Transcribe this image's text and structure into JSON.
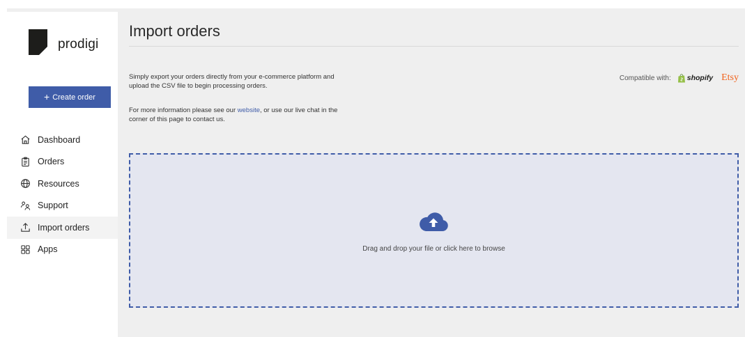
{
  "brand": {
    "name": "prodigi"
  },
  "sidebar": {
    "create_button": {
      "plus": "+",
      "label": "Create order"
    },
    "items": [
      {
        "label": "Dashboard",
        "icon": "home-icon",
        "active": false
      },
      {
        "label": "Orders",
        "icon": "clipboard-icon",
        "active": false
      },
      {
        "label": "Resources",
        "icon": "globe-icon",
        "active": false
      },
      {
        "label": "Support",
        "icon": "people-icon",
        "active": false
      },
      {
        "label": "Import orders",
        "icon": "upload-icon",
        "active": true
      },
      {
        "label": "Apps",
        "icon": "grid-icon",
        "active": false
      }
    ]
  },
  "main": {
    "title": "Import orders",
    "intro": "Simply export your orders directly from your e-commerce platform and upload the CSV file to begin processing orders.",
    "more_info": {
      "before": "For more information please see our ",
      "link": "website",
      "after": ", or use our live chat in the corner of this page to contact us."
    },
    "compatible": {
      "label": "Compatible with:",
      "platforms": [
        "shopify",
        "Etsy"
      ]
    },
    "dropzone": {
      "icon": "cloud-upload-icon",
      "text": "Drag and drop your file or click here to browse"
    }
  },
  "colors": {
    "accent": "#3f5ca8",
    "dropzone_bg": "#e4e6f0",
    "etsy": "#f1641e",
    "shopify_green": "#95bf47"
  }
}
